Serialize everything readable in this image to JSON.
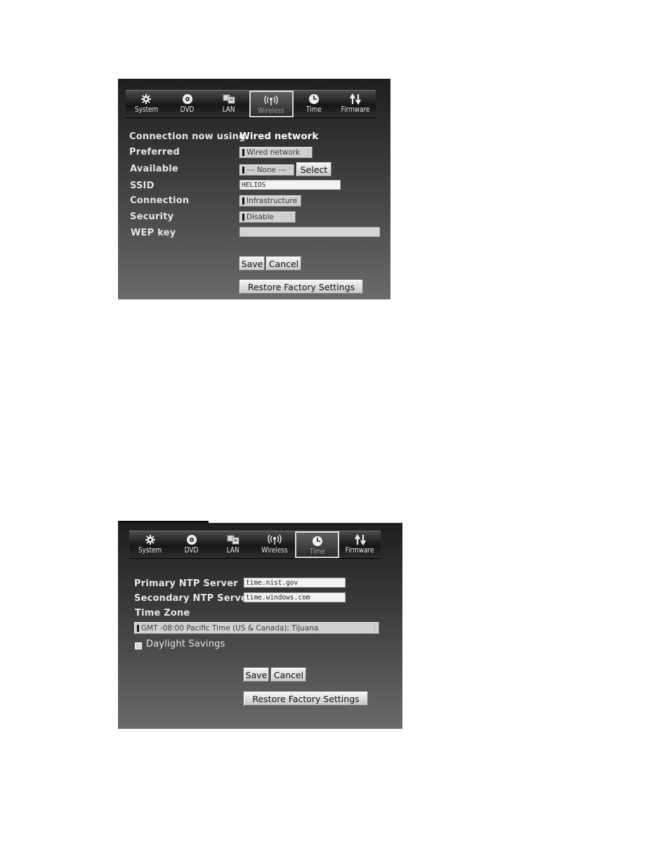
{
  "nav_tabs": [
    {
      "label": "System",
      "icon": "gear-icon"
    },
    {
      "label": "DVD",
      "icon": "disc-icon"
    },
    {
      "label": "LAN",
      "icon": "lan-icon"
    },
    {
      "label": "Wireless",
      "icon": "wireless-icon"
    },
    {
      "label": "Time",
      "icon": "clock-icon"
    },
    {
      "label": "Firmware",
      "icon": "firmware-icon"
    }
  ],
  "wireless": {
    "active_tab": "Wireless",
    "connection_label": "Connection now using",
    "connection_value": "Wired network",
    "preferred_label": "Preferred",
    "preferred_value": "Wired network",
    "available_label": "Available",
    "available_value": "--- None ---",
    "select_button": "Select",
    "ssid_label": "SSID",
    "ssid_value": "HELIOS",
    "conn_type_label": "Connection",
    "conn_type_value": "Infrastructure",
    "security_label": "Security",
    "security_value": "Disable",
    "wep_label": "WEP key",
    "wep_value": "",
    "save_button": "Save",
    "cancel_button": "Cancel",
    "restore_button": "Restore Factory Settings"
  },
  "time": {
    "active_tab": "Time",
    "primary_label": "Primary NTP Server",
    "primary_value": "time.nist.gov",
    "secondary_label": "Secondary NTP Server",
    "secondary_value": "time.windows.com",
    "timezone_label": "Time Zone",
    "timezone_value": "GMT -08:00 Pacific Time (US & Canada); Tijuana",
    "daylight_label": "Daylight Savings",
    "daylight_checked": false,
    "save_button": "Save",
    "cancel_button": "Cancel",
    "restore_button": "Restore Factory Settings"
  }
}
